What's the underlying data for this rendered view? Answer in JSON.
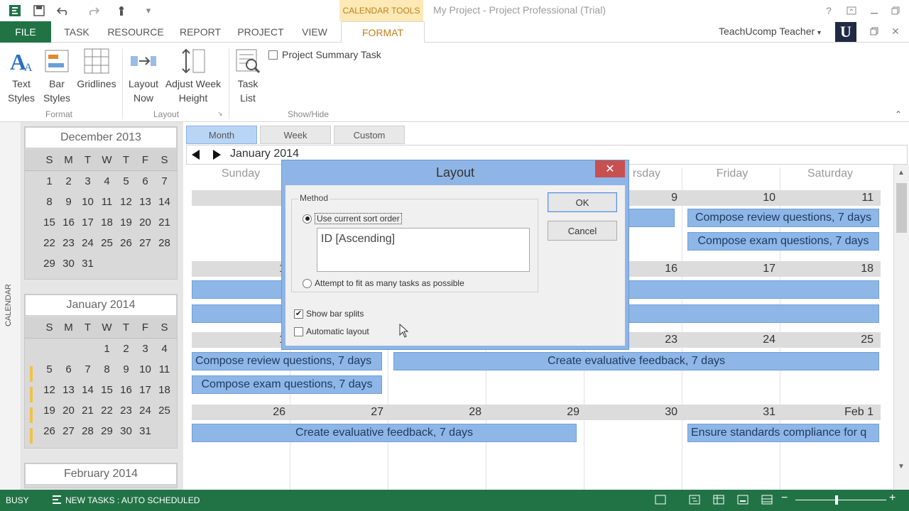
{
  "window": {
    "context_tab": "CALENDAR TOOLS",
    "title": "My Project - Project Professional (Trial)",
    "user": "TeachUcomp Teacher",
    "logo": "U"
  },
  "ribbon_tabs": [
    "FILE",
    "TASK",
    "RESOURCE",
    "REPORT",
    "PROJECT",
    "VIEW",
    "FORMAT"
  ],
  "ribbon": {
    "text_styles": [
      "Text",
      "Styles"
    ],
    "bar_styles": [
      "Bar",
      "Styles"
    ],
    "gridlines": "Gridlines",
    "layout_now": [
      "Layout",
      "Now"
    ],
    "adjust_week_height": [
      "Adjust Week",
      "Height"
    ],
    "task_list": [
      "Task",
      "List"
    ],
    "project_summary_task": "Project Summary Task",
    "groups": {
      "format": "Format",
      "layout": "Layout",
      "show_hide": "Show/Hide"
    }
  },
  "side_label": "CALENDAR",
  "mini_calendars": [
    {
      "title": "December 2013",
      "days": [
        "S",
        "M",
        "T",
        "W",
        "T",
        "F",
        "S"
      ],
      "weeks": [
        [
          "1",
          "2",
          "3",
          "4",
          "5",
          "6",
          "7"
        ],
        [
          "8",
          "9",
          "10",
          "11",
          "12",
          "13",
          "14"
        ],
        [
          "15",
          "16",
          "17",
          "18",
          "19",
          "20",
          "21"
        ],
        [
          "22",
          "23",
          "24",
          "25",
          "26",
          "27",
          "28"
        ],
        [
          "29",
          "30",
          "31",
          "",
          "",
          "",
          ""
        ]
      ]
    },
    {
      "title": "January 2014",
      "days": [
        "S",
        "M",
        "T",
        "W",
        "T",
        "F",
        "S"
      ],
      "weeks": [
        [
          "",
          "",
          "",
          "1",
          "2",
          "3",
          "4"
        ],
        [
          "5",
          "6",
          "7",
          "8",
          "9",
          "10",
          "11"
        ],
        [
          "12",
          "13",
          "14",
          "15",
          "16",
          "17",
          "18"
        ],
        [
          "19",
          "20",
          "21",
          "22",
          "23",
          "24",
          "25"
        ],
        [
          "26",
          "27",
          "28",
          "29",
          "30",
          "31",
          ""
        ]
      ]
    },
    {
      "title": "February 2014"
    }
  ],
  "view_tabs": [
    "Month",
    "Week",
    "Custom"
  ],
  "month_label": "January 2014",
  "day_names": {
    "sunday": "Sunday",
    "thursday_partial": "rsday",
    "friday": "Friday",
    "saturday": "Saturday"
  },
  "week_rows": [
    {
      "visible_numbers": {
        "thu": "9",
        "fri": "10",
        "sat": "11"
      }
    },
    {
      "visible_numbers": {
        "sun": "1",
        "thu": "16",
        "fri": "17",
        "sat": "18"
      }
    },
    {
      "visible_numbers": {
        "sun": "1",
        "thu": "23",
        "fri": "24",
        "sat": "25"
      }
    },
    {
      "visible_numbers": {
        "sun": "26",
        "mon": "27",
        "tue": "28",
        "wed": "29",
        "thu": "30",
        "fri": "31",
        "sat": "Feb 1"
      }
    }
  ],
  "tasks": {
    "compose_review": "Compose review questions, 7 days",
    "compose_exam": "Compose exam questions, 7 days",
    "create_feedback": "Create evaluative feedback, 7 days",
    "ensure_standards": "Ensure standards compliance for q"
  },
  "dialog": {
    "title": "Layout",
    "close": "✕",
    "method_label": "Method",
    "option_current_sort": "Use current sort order",
    "sort_value": "ID [Ascending]",
    "option_fit_tasks": "Attempt to fit as many tasks as possible",
    "show_bar_splits": "Show bar splits",
    "automatic_layout": "Automatic layout",
    "ok": "OK",
    "cancel": "Cancel"
  },
  "status": {
    "mode": "BUSY",
    "new_tasks": "NEW TASKS : AUTO SCHEDULED"
  },
  "colors": {
    "brand_green": "#217346",
    "task_bar": "#8eb7e8",
    "context_gold": "#c0811a"
  }
}
